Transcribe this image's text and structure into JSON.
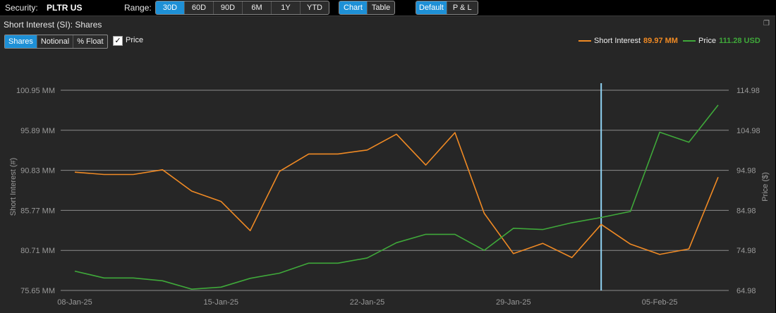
{
  "toolbar": {
    "security_label": "Security:",
    "security_value": "PLTR US",
    "range_label": "Range:",
    "ranges": [
      "30D",
      "60D",
      "90D",
      "6M",
      "1Y",
      "YTD"
    ],
    "range_active": "30D",
    "views": [
      "Chart",
      "Table"
    ],
    "view_active": "Chart",
    "modes": [
      "Default",
      "P & L"
    ],
    "mode_active": "Default"
  },
  "panel": {
    "title": "Short Interest (SI): Shares",
    "restore_icon": "restore-window-icon",
    "units": [
      "Shares",
      "Notional",
      "% Float"
    ],
    "unit_active": "Shares",
    "price_checkbox_checked": true,
    "price_checkbox_label": "Price"
  },
  "legend": {
    "short_interest_name": "Short Interest",
    "short_interest_value": "89.97 MM",
    "price_name": "Price",
    "price_value": "111.28 USD"
  },
  "colors": {
    "short_interest": "#f08a24",
    "price": "#3fa83a",
    "cursor": "#8fd3f4",
    "accent": "#1e90d6"
  },
  "chart_data": {
    "type": "line",
    "title": "",
    "ylabel": "Short Interest (#)",
    "y2label": "Price ($)",
    "ylim": [
      75.65,
      100.95
    ],
    "y2lim": [
      64.98,
      114.98
    ],
    "left_ticks": [
      "75.65 MM",
      "80.71 MM",
      "85.77 MM",
      "90.83 MM",
      "95.89 MM",
      "100.95 MM"
    ],
    "right_ticks": [
      "64.98",
      "74.98",
      "84.98",
      "94.98",
      "104.98",
      "114.98"
    ],
    "x_tick_labels": [
      "08-Jan-25",
      "15-Jan-25",
      "22-Jan-25",
      "29-Jan-25",
      "05-Feb-25"
    ],
    "x_tick_index": [
      0,
      5,
      10,
      15,
      20
    ],
    "cursor_index": 18,
    "x": [
      "08-Jan-25",
      "09-Jan-25",
      "10-Jan-25",
      "13-Jan-25",
      "14-Jan-25",
      "15-Jan-25",
      "16-Jan-25",
      "17-Jan-25",
      "21-Jan-25",
      "22-Jan-25",
      "23-Jan-25",
      "24-Jan-25",
      "27-Jan-25",
      "28-Jan-25",
      "29-Jan-25",
      "30-Jan-25",
      "31-Jan-25",
      "03-Feb-25",
      "04-Feb-25",
      "05-Feb-25",
      "06-Feb-25",
      "07-Feb-25",
      "10-Feb-25"
    ],
    "series": [
      {
        "name": "Short Interest",
        "axis": "left",
        "values": [
          90.6,
          90.3,
          90.3,
          90.9,
          88.2,
          86.9,
          83.2,
          90.7,
          92.9,
          92.9,
          93.4,
          95.4,
          91.5,
          95.6,
          85.4,
          80.3,
          81.6,
          79.8,
          84.0,
          81.5,
          80.2,
          80.9,
          89.97
        ]
      },
      {
        "name": "Price",
        "axis": "right",
        "values": [
          69.8,
          68.1,
          68.1,
          67.4,
          65.3,
          65.8,
          68.0,
          69.3,
          71.8,
          71.8,
          73.1,
          76.9,
          79.0,
          79.0,
          75.0,
          80.5,
          80.2,
          81.9,
          83.2,
          84.7,
          104.5,
          102.0,
          111.28
        ]
      }
    ]
  }
}
